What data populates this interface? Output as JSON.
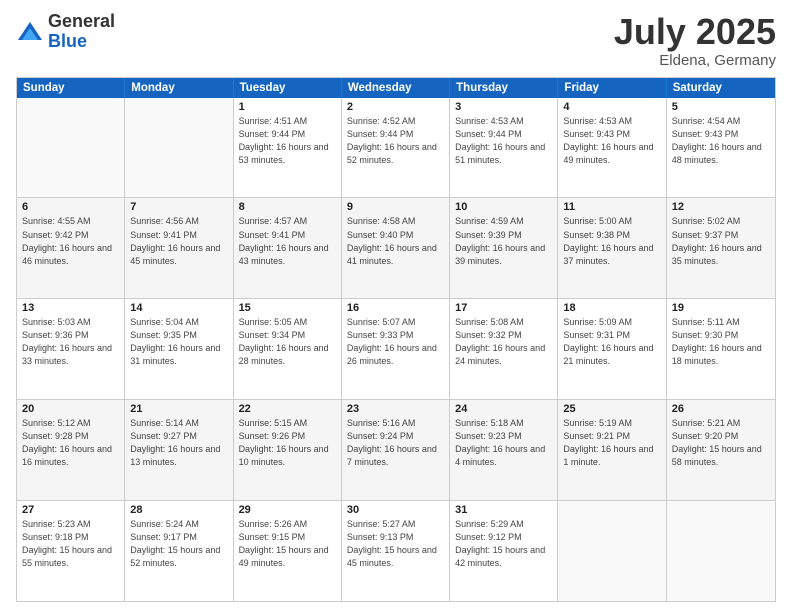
{
  "logo": {
    "general": "General",
    "blue": "Blue"
  },
  "title": {
    "month": "July 2025",
    "location": "Eldena, Germany"
  },
  "header": {
    "days": [
      "Sunday",
      "Monday",
      "Tuesday",
      "Wednesday",
      "Thursday",
      "Friday",
      "Saturday"
    ]
  },
  "weeks": [
    {
      "cells": [
        {
          "day": "",
          "info": "",
          "empty": true
        },
        {
          "day": "",
          "info": "",
          "empty": true
        },
        {
          "day": "1",
          "info": "Sunrise: 4:51 AM\nSunset: 9:44 PM\nDaylight: 16 hours and 53 minutes."
        },
        {
          "day": "2",
          "info": "Sunrise: 4:52 AM\nSunset: 9:44 PM\nDaylight: 16 hours and 52 minutes."
        },
        {
          "day": "3",
          "info": "Sunrise: 4:53 AM\nSunset: 9:44 PM\nDaylight: 16 hours and 51 minutes."
        },
        {
          "day": "4",
          "info": "Sunrise: 4:53 AM\nSunset: 9:43 PM\nDaylight: 16 hours and 49 minutes."
        },
        {
          "day": "5",
          "info": "Sunrise: 4:54 AM\nSunset: 9:43 PM\nDaylight: 16 hours and 48 minutes."
        }
      ]
    },
    {
      "cells": [
        {
          "day": "6",
          "info": "Sunrise: 4:55 AM\nSunset: 9:42 PM\nDaylight: 16 hours and 46 minutes."
        },
        {
          "day": "7",
          "info": "Sunrise: 4:56 AM\nSunset: 9:41 PM\nDaylight: 16 hours and 45 minutes."
        },
        {
          "day": "8",
          "info": "Sunrise: 4:57 AM\nSunset: 9:41 PM\nDaylight: 16 hours and 43 minutes."
        },
        {
          "day": "9",
          "info": "Sunrise: 4:58 AM\nSunset: 9:40 PM\nDaylight: 16 hours and 41 minutes."
        },
        {
          "day": "10",
          "info": "Sunrise: 4:59 AM\nSunset: 9:39 PM\nDaylight: 16 hours and 39 minutes."
        },
        {
          "day": "11",
          "info": "Sunrise: 5:00 AM\nSunset: 9:38 PM\nDaylight: 16 hours and 37 minutes."
        },
        {
          "day": "12",
          "info": "Sunrise: 5:02 AM\nSunset: 9:37 PM\nDaylight: 16 hours and 35 minutes."
        }
      ]
    },
    {
      "cells": [
        {
          "day": "13",
          "info": "Sunrise: 5:03 AM\nSunset: 9:36 PM\nDaylight: 16 hours and 33 minutes."
        },
        {
          "day": "14",
          "info": "Sunrise: 5:04 AM\nSunset: 9:35 PM\nDaylight: 16 hours and 31 minutes."
        },
        {
          "day": "15",
          "info": "Sunrise: 5:05 AM\nSunset: 9:34 PM\nDaylight: 16 hours and 28 minutes."
        },
        {
          "day": "16",
          "info": "Sunrise: 5:07 AM\nSunset: 9:33 PM\nDaylight: 16 hours and 26 minutes."
        },
        {
          "day": "17",
          "info": "Sunrise: 5:08 AM\nSunset: 9:32 PM\nDaylight: 16 hours and 24 minutes."
        },
        {
          "day": "18",
          "info": "Sunrise: 5:09 AM\nSunset: 9:31 PM\nDaylight: 16 hours and 21 minutes."
        },
        {
          "day": "19",
          "info": "Sunrise: 5:11 AM\nSunset: 9:30 PM\nDaylight: 16 hours and 18 minutes."
        }
      ]
    },
    {
      "cells": [
        {
          "day": "20",
          "info": "Sunrise: 5:12 AM\nSunset: 9:28 PM\nDaylight: 16 hours and 16 minutes."
        },
        {
          "day": "21",
          "info": "Sunrise: 5:14 AM\nSunset: 9:27 PM\nDaylight: 16 hours and 13 minutes."
        },
        {
          "day": "22",
          "info": "Sunrise: 5:15 AM\nSunset: 9:26 PM\nDaylight: 16 hours and 10 minutes."
        },
        {
          "day": "23",
          "info": "Sunrise: 5:16 AM\nSunset: 9:24 PM\nDaylight: 16 hours and 7 minutes."
        },
        {
          "day": "24",
          "info": "Sunrise: 5:18 AM\nSunset: 9:23 PM\nDaylight: 16 hours and 4 minutes."
        },
        {
          "day": "25",
          "info": "Sunrise: 5:19 AM\nSunset: 9:21 PM\nDaylight: 16 hours and 1 minute."
        },
        {
          "day": "26",
          "info": "Sunrise: 5:21 AM\nSunset: 9:20 PM\nDaylight: 15 hours and 58 minutes."
        }
      ]
    },
    {
      "cells": [
        {
          "day": "27",
          "info": "Sunrise: 5:23 AM\nSunset: 9:18 PM\nDaylight: 15 hours and 55 minutes."
        },
        {
          "day": "28",
          "info": "Sunrise: 5:24 AM\nSunset: 9:17 PM\nDaylight: 15 hours and 52 minutes."
        },
        {
          "day": "29",
          "info": "Sunrise: 5:26 AM\nSunset: 9:15 PM\nDaylight: 15 hours and 49 minutes."
        },
        {
          "day": "30",
          "info": "Sunrise: 5:27 AM\nSunset: 9:13 PM\nDaylight: 15 hours and 45 minutes."
        },
        {
          "day": "31",
          "info": "Sunrise: 5:29 AM\nSunset: 9:12 PM\nDaylight: 15 hours and 42 minutes."
        },
        {
          "day": "",
          "info": "",
          "empty": true
        },
        {
          "day": "",
          "info": "",
          "empty": true
        }
      ]
    }
  ]
}
